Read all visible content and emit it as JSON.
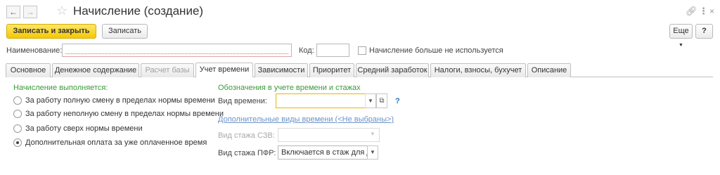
{
  "window": {
    "title": "Начисление (создание)",
    "icons": {
      "back": "arrow-left-icon",
      "forward": "arrow-right-icon",
      "favorite": "star-icon",
      "link": "link-icon",
      "more": "more-vertical-icon",
      "close": "close-icon"
    }
  },
  "toolbar": {
    "save_close_label": "Записать и закрыть",
    "save_label": "Записать",
    "more_label": "Еще",
    "help_label": "?"
  },
  "form": {
    "name_label": "Наименование:",
    "name_value": "",
    "code_label": "Код:",
    "code_value": "",
    "deprecated_label": "Начисление больше не используется",
    "deprecated_checked": false
  },
  "tabs": [
    {
      "label": "Основное",
      "active": false,
      "disabled": false
    },
    {
      "label": "Денежное содержание",
      "active": false,
      "disabled": false
    },
    {
      "label": "Расчет базы",
      "active": false,
      "disabled": true
    },
    {
      "label": "Учет времени",
      "active": true,
      "disabled": false
    },
    {
      "label": "Зависимости",
      "active": false,
      "disabled": false
    },
    {
      "label": "Приоритет",
      "active": false,
      "disabled": false
    },
    {
      "label": "Средний заработок",
      "active": false,
      "disabled": false
    },
    {
      "label": "Налоги, взносы, бухучет",
      "active": false,
      "disabled": false
    },
    {
      "label": "Описание",
      "active": false,
      "disabled": false
    }
  ],
  "accrual": {
    "section_title": "Начисление выполняется:",
    "options": [
      {
        "label": "За работу полную смену в пределах нормы времени",
        "checked": false
      },
      {
        "label": "За работу неполную смену в пределах нормы времени",
        "checked": false
      },
      {
        "label": "За работу сверх нормы времени",
        "checked": false
      },
      {
        "label": "Дополнительная оплата за уже оплаченное время",
        "checked": true
      }
    ]
  },
  "time_tracking": {
    "section_title": "Обозначения в учете времени и стажах",
    "time_type_label": "Вид времени:",
    "time_type_value": "",
    "help_mark": "?",
    "additional_link": "Дополнительные виды времени (<Не выбраны>)",
    "szv_label": "Вид стажа СЗВ:",
    "szv_value": "",
    "pfr_label": "Вид стажа ПФР:",
    "pfr_value": "Включается в стаж для д"
  }
}
